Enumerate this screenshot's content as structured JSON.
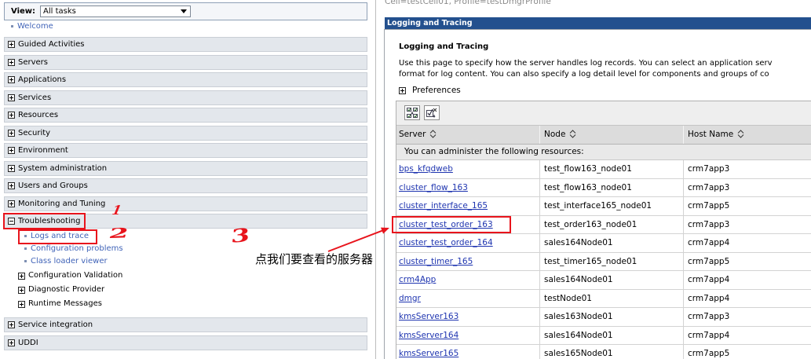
{
  "nav": {
    "view_label": "View:",
    "view_selected": "All tasks",
    "welcome": "Welcome",
    "sections": [
      "Guided Activities",
      "Servers",
      "Applications",
      "Services",
      "Resources",
      "Security",
      "Environment",
      "System administration",
      "Users and Groups",
      "Monitoring and Tuning"
    ],
    "troubleshooting": {
      "label": "Troubleshooting",
      "links": [
        "Logs and trace",
        "Configuration problems",
        "Class loader viewer"
      ],
      "groups": [
        "Configuration Validation",
        "Diagnostic Provider",
        "Runtime Messages"
      ]
    },
    "sections_after": [
      "Service integration",
      "UDDI"
    ]
  },
  "header": {
    "context": "Cell=testCell01, Profile=testDmgrProfile"
  },
  "panel": {
    "title_bar": "Logging and Tracing",
    "heading": "Logging and Tracing",
    "description": [
      "Use this page to specify how the server handles log records. You can select an application serv",
      "format for log content. You can also specify a log detail level for components and groups of co"
    ],
    "preferences": "Preferences"
  },
  "table": {
    "columns": [
      "Server",
      "Node",
      "Host Name"
    ],
    "info": "You can administer the following resources:",
    "rows": [
      {
        "server": "bps_kfqdweb",
        "node": "test_flow163_node01",
        "host": "crm7app3"
      },
      {
        "server": "cluster_flow_163",
        "node": "test_flow163_node01",
        "host": "crm7app3"
      },
      {
        "server": "cluster_interface_165",
        "node": "test_interface165_node01",
        "host": "crm7app5"
      },
      {
        "server": "cluster_test_order_163",
        "node": "test_order163_node01",
        "host": "crm7app3"
      },
      {
        "server": "cluster_test_order_164",
        "node": "sales164Node01",
        "host": "crm7app4"
      },
      {
        "server": "cluster_timer_165",
        "node": "test_timer165_node01",
        "host": "crm7app5"
      },
      {
        "server": "crm4App",
        "node": "sales164Node01",
        "host": "crm7app4"
      },
      {
        "server": "dmgr",
        "node": "testNode01",
        "host": "crm7app4"
      },
      {
        "server": "kmsServer163",
        "node": "sales163Node01",
        "host": "crm7app3"
      },
      {
        "server": "kmsServer164",
        "node": "sales164Node01",
        "host": "crm7app4"
      },
      {
        "server": "kmsServer165",
        "node": "sales165Node01",
        "host": "crm7app5"
      }
    ]
  },
  "annotations": {
    "steps": [
      "1",
      "2",
      "3"
    ],
    "note": "点我们要查看的服务器"
  },
  "icons": {
    "expand": "expand-icon",
    "collapse": "collapse-icon",
    "sort": "sort-icon",
    "select_all": "select-all-icon",
    "deselect_all": "deselect-all-icon",
    "dropdown": "chevron-down-icon"
  },
  "colors": {
    "title_bar": "#23508e",
    "link": "#1f35b0",
    "nav_link": "#4164b8",
    "annotation": "#e8141c"
  }
}
